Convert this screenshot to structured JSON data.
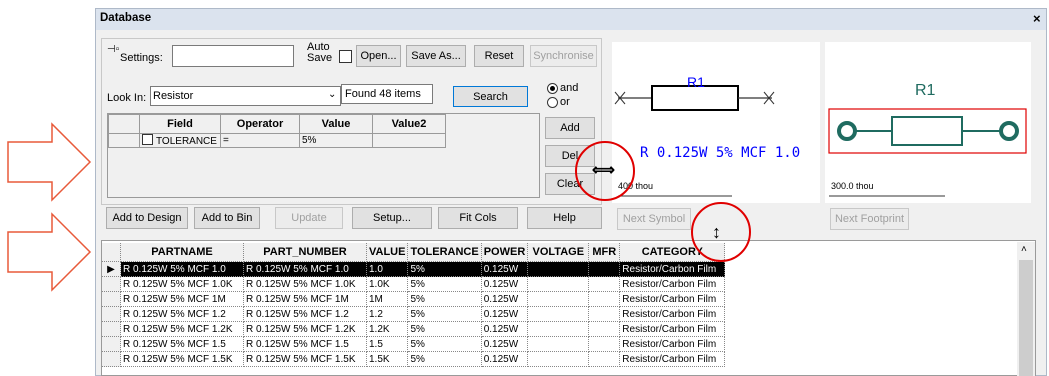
{
  "window": {
    "title": "Database",
    "close": "×"
  },
  "toolbar": {
    "settings_label": "Settings:",
    "auto_save_label": "Auto Save",
    "open": "Open...",
    "save_as": "Save As...",
    "reset": "Reset",
    "synchronise": "Synchronise"
  },
  "search": {
    "look_in_label": "Look In:",
    "look_in_value": "Resistor",
    "found_text": "Found 48 items",
    "search_button": "Search",
    "and_label": "and",
    "or_label": "or",
    "add_button": "Add",
    "del_button": "Del",
    "clear_button": "Clear"
  },
  "query_table": {
    "headers": [
      "Field",
      "Operator",
      "Value",
      "Value2"
    ],
    "rows": [
      {
        "field": "TOLERANCE",
        "operator": "=",
        "value": "5%",
        "value2": ""
      }
    ]
  },
  "actions": {
    "add_to_design": "Add to Design",
    "add_to_bin": "Add to Bin",
    "update": "Update",
    "setup": "Setup...",
    "fit_cols": "Fit Cols",
    "help": "Help"
  },
  "preview": {
    "symbol_ref": "R1",
    "symbol_value": "R 0.125W 5% MCF 1.0",
    "symbol_scale": "400 thou",
    "footprint_ref": "R1",
    "footprint_scale": "300.0 thou",
    "next_symbol": "Next Symbol",
    "next_footprint": "Next Footprint"
  },
  "results": {
    "headers": [
      "PARTNAME",
      "PART_NUMBER",
      "VALUE",
      "TOLERANCE",
      "POWER",
      "VOLTAGE",
      "MFR",
      "CATEGORY"
    ],
    "rows": [
      [
        "R 0.125W 5% MCF 1.0",
        "R 0.125W 5% MCF 1.0",
        "1.0",
        "5%",
        "0.125W",
        "",
        "",
        "Resistor/Carbon Film"
      ],
      [
        "R 0.125W 5% MCF 1.0K",
        "R 0.125W 5% MCF 1.0K",
        "1.0K",
        "5%",
        "0.125W",
        "",
        "",
        "Resistor/Carbon Film"
      ],
      [
        "R 0.125W 5% MCF 1M",
        "R 0.125W 5% MCF 1M",
        "1M",
        "5%",
        "0.125W",
        "",
        "",
        "Resistor/Carbon Film"
      ],
      [
        "R 0.125W 5% MCF 1.2",
        "R 0.125W 5% MCF 1.2",
        "1.2",
        "5%",
        "0.125W",
        "",
        "",
        "Resistor/Carbon Film"
      ],
      [
        "R 0.125W 5% MCF 1.2K",
        "R 0.125W 5% MCF 1.2K",
        "1.2K",
        "5%",
        "0.125W",
        "",
        "",
        "Resistor/Carbon Film"
      ],
      [
        "R 0.125W 5% MCF 1.5",
        "R 0.125W 5% MCF 1.5",
        "1.5",
        "5%",
        "0.125W",
        "",
        "",
        "Resistor/Carbon Film"
      ],
      [
        "R 0.125W 5% MCF 1.5K",
        "R 0.125W 5% MCF 1.5K",
        "1.5K",
        "5%",
        "0.125W",
        "",
        "",
        "Resistor/Carbon Film"
      ]
    ],
    "selected_row": 0
  },
  "colors": {
    "symbol_blue": "#0000ff",
    "footprint_teal": "#1f6b60",
    "highlight_red": "#e00000",
    "arrow_red": "#e85a3a"
  }
}
